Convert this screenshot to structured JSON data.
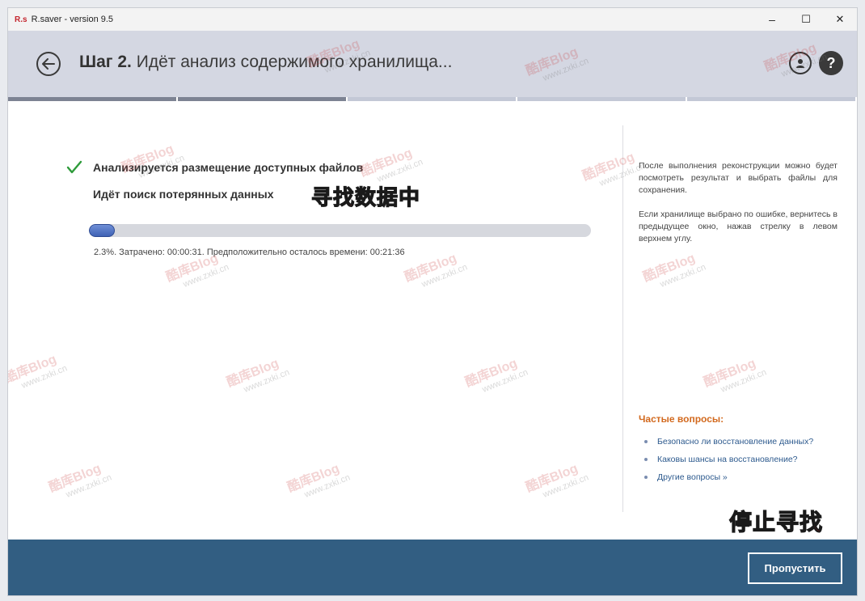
{
  "window": {
    "logo": "R.s",
    "title": "R.saver - version 9.5",
    "controls": {
      "minimize": "–",
      "maximize": "☐",
      "close": "✕"
    }
  },
  "header": {
    "step_label": "Шаг 2.",
    "step_title": "Идёт анализ содержимого хранилища...",
    "help_label": "?"
  },
  "steps": {
    "total": 5,
    "completed": 2
  },
  "main": {
    "task_done": "Анализируется размещение доступных файлов",
    "task_current": "Идёт поиск потерянных данных",
    "progress": {
      "percent": 2.3,
      "text": "2.3%. Затрачено: 00:00:31. Предположительно осталось времени: 00:21:36"
    },
    "annotation_search": "寻找数据中"
  },
  "side": {
    "info_1": "После выполнения реконструкции можно будет посмотреть результат и выбрать файлы для сохранения.",
    "info_2": "Если хранилище выбрано по ошибке, вернитесь в предыдущее окно, нажав стрелку в левом верхнем углу.",
    "faq_title": "Частые вопросы:",
    "faq": [
      "Безопасно ли восстановление данных?",
      "Каковы шансы на восстановление?",
      "Другие вопросы »"
    ]
  },
  "annotation_stop": "停止寻找",
  "footer": {
    "skip_label": "Пропустить"
  },
  "watermark": {
    "brand": "酷库Blog",
    "url": "www.zxki.cn"
  },
  "colors": {
    "accent_header": "#d4d7e2",
    "footer": "#325e82",
    "progress": "#3f62b5",
    "faq_title": "#d2691e",
    "check": "#2e9b3a"
  }
}
